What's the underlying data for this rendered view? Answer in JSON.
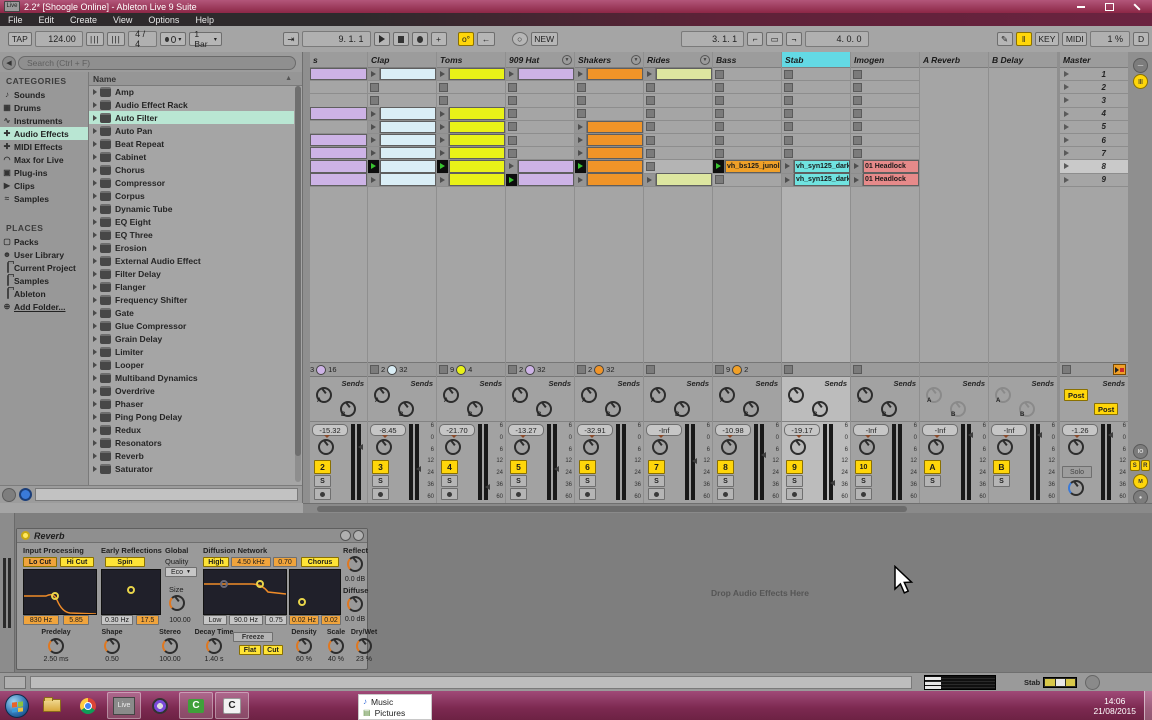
{
  "window": {
    "title": "2.2* [Shoogle Online] - Ableton Live 9 Suite",
    "app_badge": "Live",
    "menu": [
      "File",
      "Edit",
      "Create",
      "View",
      "Options",
      "Help"
    ]
  },
  "transport": {
    "tap": "TAP",
    "tempo": "124.00",
    "signature": "4 / 4",
    "quantize": "1 Bar",
    "position": "9. 1. 1",
    "new_label": "NEW",
    "loop_start": "3. 1. 1",
    "loop_length": "4. 0. 0",
    "key_label": "KEY",
    "midi_label": "MIDI",
    "cpu": "1 %",
    "overload": "D"
  },
  "browser": {
    "search_placeholder": "Search (Ctrl + F)",
    "categories_title": "CATEGORIES",
    "categories": [
      {
        "label": "Sounds",
        "icon": "note",
        "glyph": "♪"
      },
      {
        "label": "Drums",
        "icon": "drum-grid",
        "glyph": "▦"
      },
      {
        "label": "Instruments",
        "icon": "wave",
        "glyph": "∿"
      },
      {
        "label": "Audio Effects",
        "icon": "audio-fx",
        "glyph": "✚",
        "selected": true
      },
      {
        "label": "MIDI Effects",
        "icon": "midi-fx",
        "glyph": "✚"
      },
      {
        "label": "Max for Live",
        "icon": "max",
        "glyph": "◠"
      },
      {
        "label": "Plug-ins",
        "icon": "plug",
        "glyph": "▣"
      },
      {
        "label": "Clips",
        "icon": "clip",
        "glyph": "▶"
      },
      {
        "label": "Samples",
        "icon": "sample",
        "glyph": "≈"
      }
    ],
    "places_title": "PLACES",
    "places": [
      {
        "label": "Packs",
        "icon": "pack"
      },
      {
        "label": "User Library",
        "icon": "user"
      },
      {
        "label": "Current Project",
        "icon": "project"
      },
      {
        "label": "Samples",
        "icon": "folder"
      },
      {
        "label": "Ableton",
        "icon": "folder"
      },
      {
        "label": "Add Folder...",
        "icon": "add-folder",
        "underline": true
      }
    ],
    "name_header": "Name",
    "selected_device": "Auto Filter",
    "devices": [
      "Amp",
      "Audio Effect Rack",
      "Auto Filter",
      "Auto Pan",
      "Beat Repeat",
      "Cabinet",
      "Chorus",
      "Compressor",
      "Corpus",
      "Dynamic Tube",
      "EQ Eight",
      "EQ Three",
      "Erosion",
      "External Audio Effect",
      "Filter Delay",
      "Flanger",
      "Frequency Shifter",
      "Gate",
      "Glue Compressor",
      "Grain Delay",
      "Limiter",
      "Looper",
      "Multiband Dynamics",
      "Overdrive",
      "Phaser",
      "Ping Pong Delay",
      "Redux",
      "Resonators",
      "Reverb",
      "Saturator"
    ]
  },
  "session": {
    "sends_label": "Sends",
    "solo_label": "S",
    "meter_scale": [
      "6",
      "0",
      "6",
      "12",
      "24",
      "36",
      "60"
    ],
    "scenes": [
      "1",
      "2",
      "3",
      "4",
      "5",
      "6",
      "7",
      "8",
      "9"
    ],
    "selected_scene": "8",
    "tracks": [
      {
        "name": "s",
        "type": "audio",
        "partial": true,
        "clip_color": "#cdb3e6",
        "number": "2",
        "volume": "-15.32",
        "peak": 22,
        "status": {
          "count": "3",
          "length": "16",
          "dot": "#cdb3e6"
        },
        "slots": [
          "clip",
          "",
          "",
          "clip",
          "",
          "clip",
          "clip",
          "clip",
          "clip"
        ]
      },
      {
        "name": "Clap",
        "type": "audio",
        "clip_color": "#daeef6",
        "number": "3",
        "volume": "-8.45",
        "peak": 44,
        "status": {
          "count": "2",
          "length": "32",
          "dot": "#daeef6"
        },
        "slots": [
          "clip",
          "stop",
          "stop",
          "clip",
          "clip",
          "clip",
          "clip",
          "play",
          "clip"
        ]
      },
      {
        "name": "Toms",
        "type": "audio",
        "clip_color": "#e9f218",
        "number": "4",
        "volume": "-21.70",
        "peak": 62,
        "status": {
          "count": "9",
          "length": "4",
          "dot": "#e9f218"
        },
        "slots": [
          "clip",
          "stop",
          "stop",
          "clip",
          "clip",
          "clip",
          "clip",
          "play",
          "clip"
        ]
      },
      {
        "name": "909 Hat",
        "type": "audio",
        "fold": true,
        "clip_color": "#cdb3e6",
        "number": "5",
        "volume": "-13.27",
        "peak": 44,
        "status": {
          "count": "2",
          "length": "32",
          "dot": "#cdb3e6"
        },
        "slots": [
          "clip",
          "stop",
          "stop",
          "stop",
          "stop",
          "stop",
          "stop",
          "clip",
          "play"
        ]
      },
      {
        "name": "Shakers",
        "type": "audio",
        "fold": true,
        "clip_color": "#f09428",
        "number": "6",
        "volume": "-32.91",
        "peak": null,
        "status": {
          "count": "2",
          "length": "32",
          "dot": "#f09428"
        },
        "slots": [
          "clip",
          "stop",
          "stop",
          "stop",
          "clip",
          "clip",
          "clip",
          "play",
          "clip"
        ]
      },
      {
        "name": "Rides",
        "type": "audio",
        "fold": true,
        "clip_color": "#dde6a0",
        "number": "7",
        "volume": "-Inf",
        "peak": 36,
        "status": {},
        "slots": [
          "clip",
          "stop",
          "stop",
          "stop",
          "stop",
          "stop",
          "stop",
          "stop",
          "clip"
        ]
      },
      {
        "name": "Bass",
        "type": "audio",
        "clip_color": "#f0a028",
        "number": "8",
        "volume": "-10.98",
        "peak": 30,
        "status": {
          "count": "9",
          "length": "2",
          "dot": "#f0a028"
        },
        "slots": [
          "stop",
          "stop",
          "stop",
          "stop",
          "stop",
          "stop",
          "stop",
          "play:vh_bs125_junol",
          "stop"
        ]
      },
      {
        "name": "Stab",
        "type": "audio",
        "selected": true,
        "clip_color": "#70e3e0",
        "number": "9",
        "volume": "-19.17",
        "peak": 58,
        "status": {},
        "slots": [
          "stop",
          "stop",
          "stop",
          "stop",
          "stop",
          "stop",
          "stop",
          "clip:vh_syn125_dark",
          "clip:vh_syn125_dark"
        ]
      },
      {
        "name": "Imogen",
        "type": "audio",
        "clip_color": "#e68a8a",
        "number": "10",
        "volume": "-Inf",
        "peak": null,
        "status": {},
        "slots": [
          "stop",
          "stop",
          "stop",
          "stop",
          "stop",
          "stop",
          "stop",
          "clip:01 Headlock",
          "clip:01 Headlock"
        ]
      },
      {
        "name": "A Reverb",
        "type": "return",
        "number": "A",
        "volume": "-Inf",
        "peak": 10
      },
      {
        "name": "B Delay",
        "type": "return",
        "number": "B",
        "volume": "-Inf",
        "peak": 10
      },
      {
        "name": "Master",
        "type": "master",
        "volume": "-1.26",
        "peak": 10,
        "solo_label": "Solo",
        "post_a": "Post",
        "post_b": "Post"
      }
    ]
  },
  "device": {
    "title": "Reverb",
    "input_label": "Input Processing",
    "lo_cut": "Lo Cut",
    "hi_cut": "Hi Cut",
    "input_freq": "830 Hz",
    "input_q": "5.85",
    "early_label": "Early Reflections",
    "spin": "Spin",
    "spin_rate": "0.30 Hz",
    "spin_amount": "17.5",
    "global_label": "Global",
    "quality_label": "Quality",
    "quality": "Eco",
    "size_label": "Size",
    "size": "100.00",
    "diffusion_label": "Diffusion Network",
    "high": "High",
    "high_freq": "4.50 kHz",
    "high_q": "0.70",
    "chorus": "Chorus",
    "low": "Low",
    "low_freq": "90.0 Hz",
    "low_q": "0.75",
    "chorus_rate": "0.02 Hz",
    "chorus_amount": "0.02",
    "reflect_label": "Reflect",
    "reflect_value": "0.0 dB",
    "diffuse_label": "Diffuse",
    "diffuse_value": "0.0 dB",
    "freeze": "Freeze",
    "flat": "Flat",
    "cut": "Cut",
    "knobs_left": [
      {
        "label": "Predelay",
        "value": "2.50 ms"
      },
      {
        "label": "Shape",
        "value": "0.50"
      },
      {
        "label": "Stereo",
        "value": "100.00"
      },
      {
        "label": "Decay Time",
        "value": "1.40 s"
      }
    ],
    "knobs_right": [
      {
        "label": "Density",
        "value": "60 %"
      },
      {
        "label": "Scale",
        "value": "40 %"
      },
      {
        "label": "Dry/Wet",
        "value": "23 %"
      }
    ]
  },
  "drop_zone_label": "Drop Audio Effects Here",
  "statusbar": {
    "clip_name": "Stab"
  },
  "taskbar": {
    "time": "14:06",
    "date": "21/08/2015",
    "flyout": [
      {
        "label": "Music",
        "glyph": "♪"
      },
      {
        "label": "Pictures",
        "glyph": "▤"
      }
    ]
  }
}
